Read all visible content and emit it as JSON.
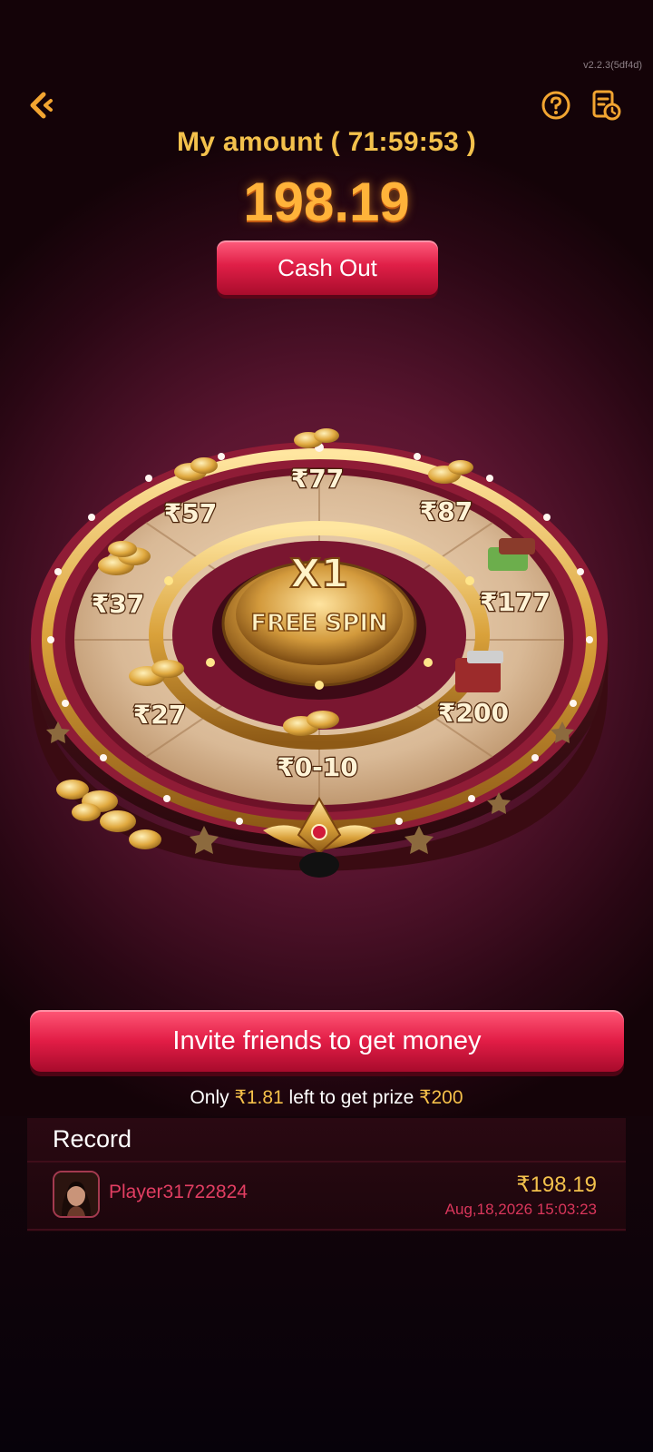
{
  "app": {
    "version": "v2.2.3(5df4d)"
  },
  "header": {
    "back_icon": "back-arrow-icon",
    "help_icon": "question-circle-icon",
    "history_icon": "history-document-icon"
  },
  "balance": {
    "label": "My amount",
    "timer": "71:59:53",
    "label_full": "My amount ( 71:59:53 )",
    "value": "198.19",
    "cash_out_label": "Cash Out"
  },
  "wheel": {
    "center_multiplier": "X1",
    "center_text": "FREE SPIN",
    "prizes": [
      {
        "label": "₹77"
      },
      {
        "label": "₹87"
      },
      {
        "label": "₹177"
      },
      {
        "label": "₹200"
      },
      {
        "label": "₹0-10"
      },
      {
        "label": "₹27"
      },
      {
        "label": "₹37"
      },
      {
        "label": "₹57"
      }
    ]
  },
  "invite": {
    "button_label": "Invite friends to get money",
    "progress_prefix": "Only",
    "remaining": "₹1.81",
    "progress_middle": "left to get prize",
    "prize": "₹200"
  },
  "record": {
    "title": "Record",
    "items": [
      {
        "player": "Player31722824",
        "amount": "₹198.19",
        "time": "Aug,18,2026 15:03:23"
      }
    ]
  },
  "colors": {
    "accent_gold": "#f3c14c",
    "button_red": "#e01f47",
    "player_name": "#e23e62",
    "background": "#5a1530"
  }
}
